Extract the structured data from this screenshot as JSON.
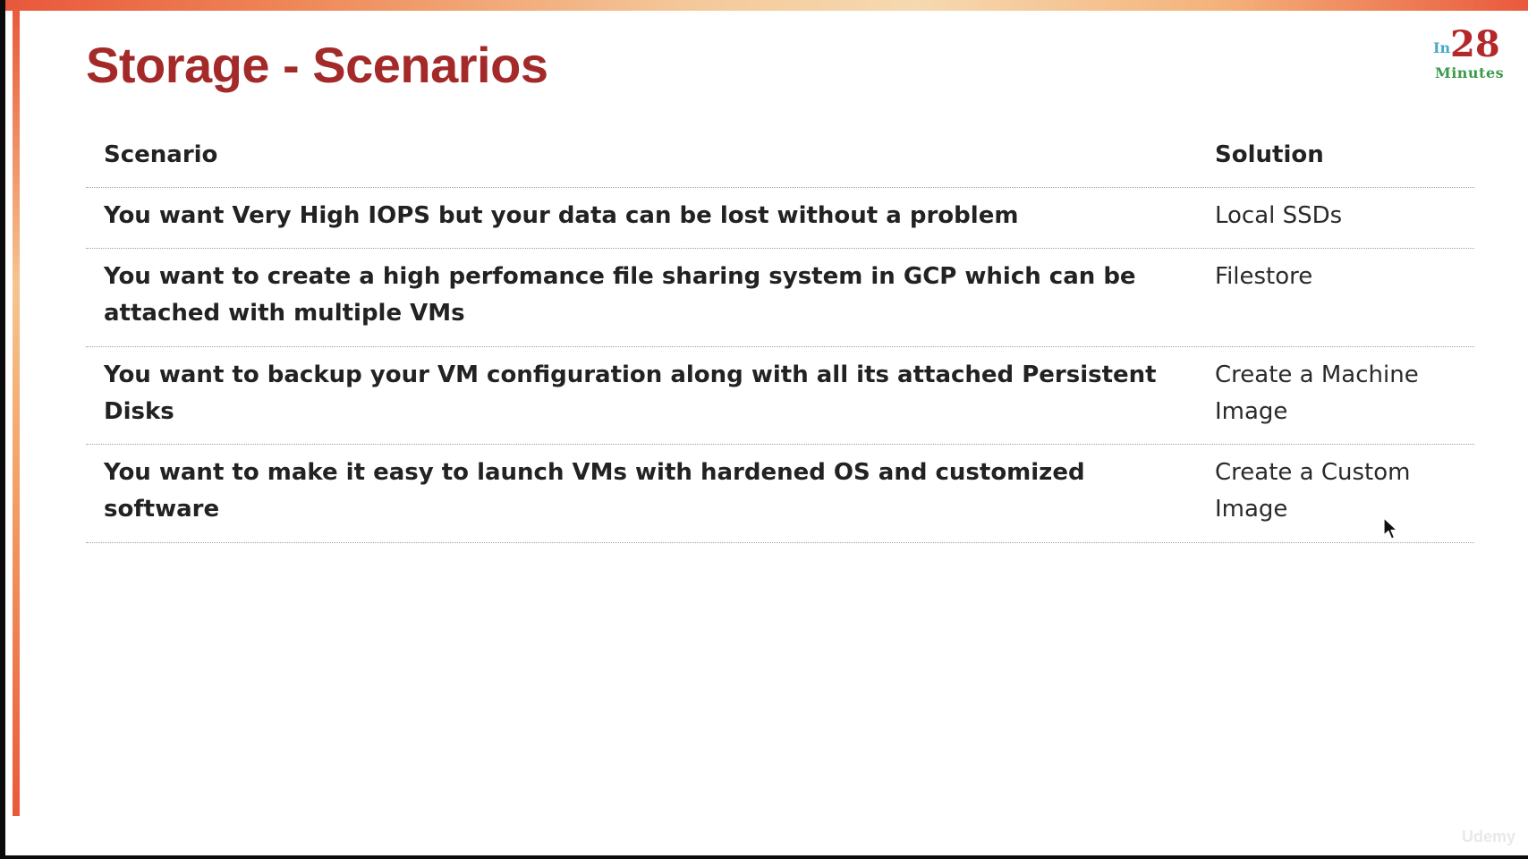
{
  "slide": {
    "title": "Storage - Scenarios",
    "accent_color": "#a42a2a",
    "logo": {
      "prefix": "In",
      "number": "28",
      "suffix": "Minutes"
    },
    "watermark": "Udemy"
  },
  "table": {
    "headers": {
      "scenario": "Scenario",
      "solution": "Solution"
    },
    "rows": [
      {
        "scenario": "You want Very High IOPS but your data can be lost without a problem",
        "solution": "Local SSDs"
      },
      {
        "scenario": "You want to create a high perfomance file sharing system in GCP which can be attached with multiple VMs",
        "solution": "Filestore"
      },
      {
        "scenario": "You want to backup your VM configuration along with all its attached Persistent Disks",
        "solution": "Create a Machine Image"
      },
      {
        "scenario": "You want to make it easy to launch VMs with hardened OS and customized software",
        "solution": "Create a Custom Image"
      }
    ]
  },
  "icons": {
    "cursor": "mouse-pointer-icon"
  }
}
